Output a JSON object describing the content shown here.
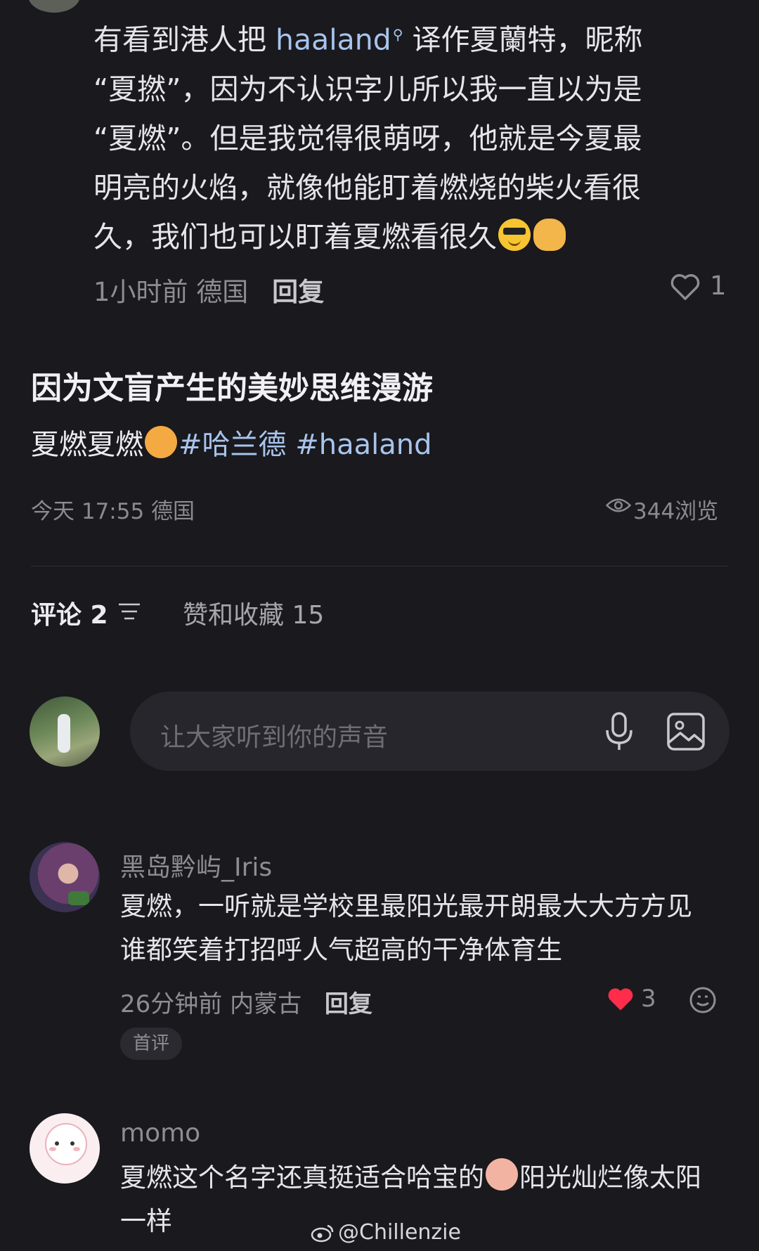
{
  "top_comment": {
    "lines": [
      "“夏撚”，因为不认识字儿所以我一直以为是",
      "“夏燃”。但是我觉得很萌呀，他就是今夏最",
      "明亮的火焰，就像他能盯着燃烧的柴火看很",
      "久，我们也可以盯着夏燃看很久"
    ],
    "line1_pre": "有看到港人把 ",
    "line1_link": "haaland",
    "line1_post": " 译作夏蘭特，昵称",
    "time": "1小时前",
    "location": "德国",
    "reply": "回复",
    "likes": "1"
  },
  "post": {
    "title": "因为文盲产生的美妙思维漫游",
    "body_text": "夏燃夏燃",
    "tags": [
      "#哈兰德",
      "#haaland"
    ],
    "timestamp": "今天 17:55",
    "location": "德国",
    "views": "344浏览"
  },
  "tabs": {
    "comments": "评论 2",
    "likes_favs": "赞和收藏 15"
  },
  "input": {
    "placeholder": "让大家听到你的声音"
  },
  "comments": [
    {
      "user": "黑岛黔屿_Iris",
      "lines": [
        "夏燃，一听就是学校里最阳光最开朗最大大方方见",
        "谁都笑着打招呼人气超高的干净体育生"
      ],
      "time": "26分钟前",
      "location": "内蒙古",
      "reply": "回复",
      "likes": "3",
      "badge": "首评"
    },
    {
      "user": "momo",
      "line1_pre": "夏燃这个名字还真挺适合哈宝的",
      "line1_post": "阳光灿烂像太阳",
      "line2": "一样"
    }
  ],
  "watermark": "@Chillenzie",
  "colors": {
    "background": "#19191e",
    "link": "#a8c4ec",
    "like_red": "#ff2d4a",
    "muted": "#8d8d93"
  },
  "icons": [
    "heart-outline-icon",
    "eye-icon",
    "filter-icon",
    "microphone-icon",
    "image-icon",
    "heart-filled-icon",
    "emoji-icon",
    "weibo-icon"
  ]
}
